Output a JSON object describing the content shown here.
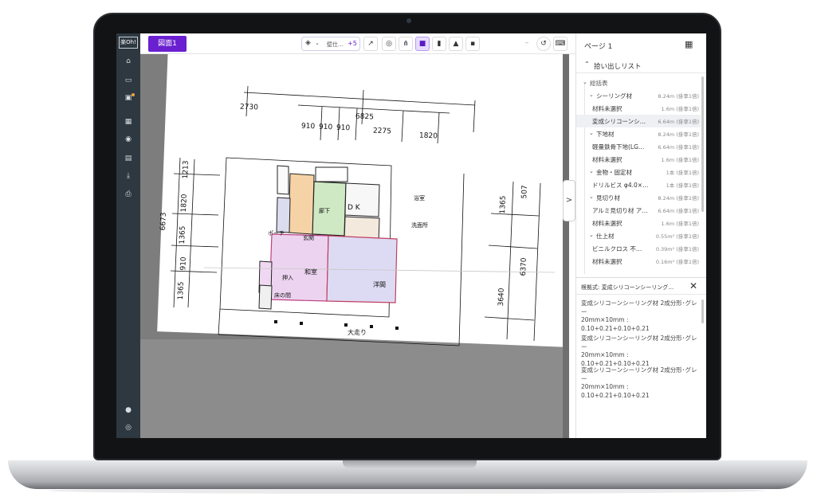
{
  "app": {
    "logo": "楽Oh!"
  },
  "leftnav": {
    "icons": [
      "home-icon",
      "folder-icon",
      "save-icon",
      "table-icon",
      "eye-icon",
      "archive-icon",
      "download-icon",
      "print-icon",
      "user-icon",
      "info-icon"
    ]
  },
  "toolbar": {
    "sheet_tab": "図面1",
    "layer_label": "壁仕…",
    "layer_more": "+5"
  },
  "panel": {
    "page_label": "ページ 1",
    "pick_list_title": "拾い出しリスト",
    "tree": [
      {
        "label": "総括表",
        "value": "",
        "level": 0,
        "type": "group"
      },
      {
        "label": "シーリング材",
        "value": "8.24m (掛率1倍)",
        "level": 1,
        "type": "category"
      },
      {
        "label": "材料未選択",
        "value": "1.6m (掛率1倍)",
        "level": 2,
        "type": "item"
      },
      {
        "label": "変成シリコーンシ…",
        "value": "6.64m (掛率1倍)",
        "level": 2,
        "type": "item",
        "selected": true
      },
      {
        "label": "下地材",
        "value": "8.24m (掛率1倍)",
        "level": 1,
        "type": "category"
      },
      {
        "label": "軽量鉄骨下地(LG…",
        "value": "6.64m (掛率1倍)",
        "level": 2,
        "type": "item"
      },
      {
        "label": "材料未選択",
        "value": "1.6m (掛率1倍)",
        "level": 2,
        "type": "item"
      },
      {
        "label": "金物・固定材",
        "value": "1本 (掛率1倍)",
        "level": 1,
        "type": "category"
      },
      {
        "label": "ドリルビス φ4.0×2…",
        "value": "1本 (掛率1倍)",
        "level": 2,
        "type": "item"
      },
      {
        "label": "見切り材",
        "value": "8.24m (掛率1倍)",
        "level": 1,
        "type": "category"
      },
      {
        "label": "アルミ見切り材 ア…",
        "value": "6.64m (掛率1倍)",
        "level": 2,
        "type": "item"
      },
      {
        "label": "材料未選択",
        "value": "1.6m (掛率1倍)",
        "level": 2,
        "type": "item"
      },
      {
        "label": "仕上材",
        "value": "0.55m² (掛率1倍)",
        "level": 1,
        "type": "category"
      },
      {
        "label": "ビニルクロス 不…",
        "value": "0.39m² (掛率1倍)",
        "level": 2,
        "type": "item"
      },
      {
        "label": "材料未選択",
        "value": "0.16m² (掛率1倍)",
        "level": 2,
        "type": "item"
      }
    ],
    "detail_title": "根拠式: 変成シリコーンシーリング…",
    "detail_items": [
      {
        "line1": "変成シリコーンシーリング材 2成分形･グレー",
        "line2": "20mm×10mm :",
        "line3": "0.10+0.21+0.10+0.21"
      },
      {
        "line1": "変成シリコーンシーリング材 2成分形･グレー",
        "line2": "20mm×10mm :",
        "line3": "0.10+0.21+0.10+0.21"
      },
      {
        "line1": "変成シリコーンシーリング材 2成分形･グレー",
        "line2": "20mm×10mm :",
        "line3": "0.10+0.21+0.10+0.21"
      }
    ]
  },
  "plan": {
    "dims_top": [
      "2730",
      "6825",
      "910",
      "910",
      "910",
      "2275",
      "1820"
    ],
    "dims_left": [
      "6673",
      "1365",
      "910",
      "1365",
      "1820",
      "1213"
    ],
    "dims_right": [
      "1365",
      "507",
      "6370",
      "3640"
    ],
    "rooms": [
      "D K",
      "和室",
      "洋間",
      "押入",
      "床の間",
      "廊下",
      "玄関",
      "ポーチ",
      "浴室",
      "洗面所",
      "大走り"
    ]
  }
}
